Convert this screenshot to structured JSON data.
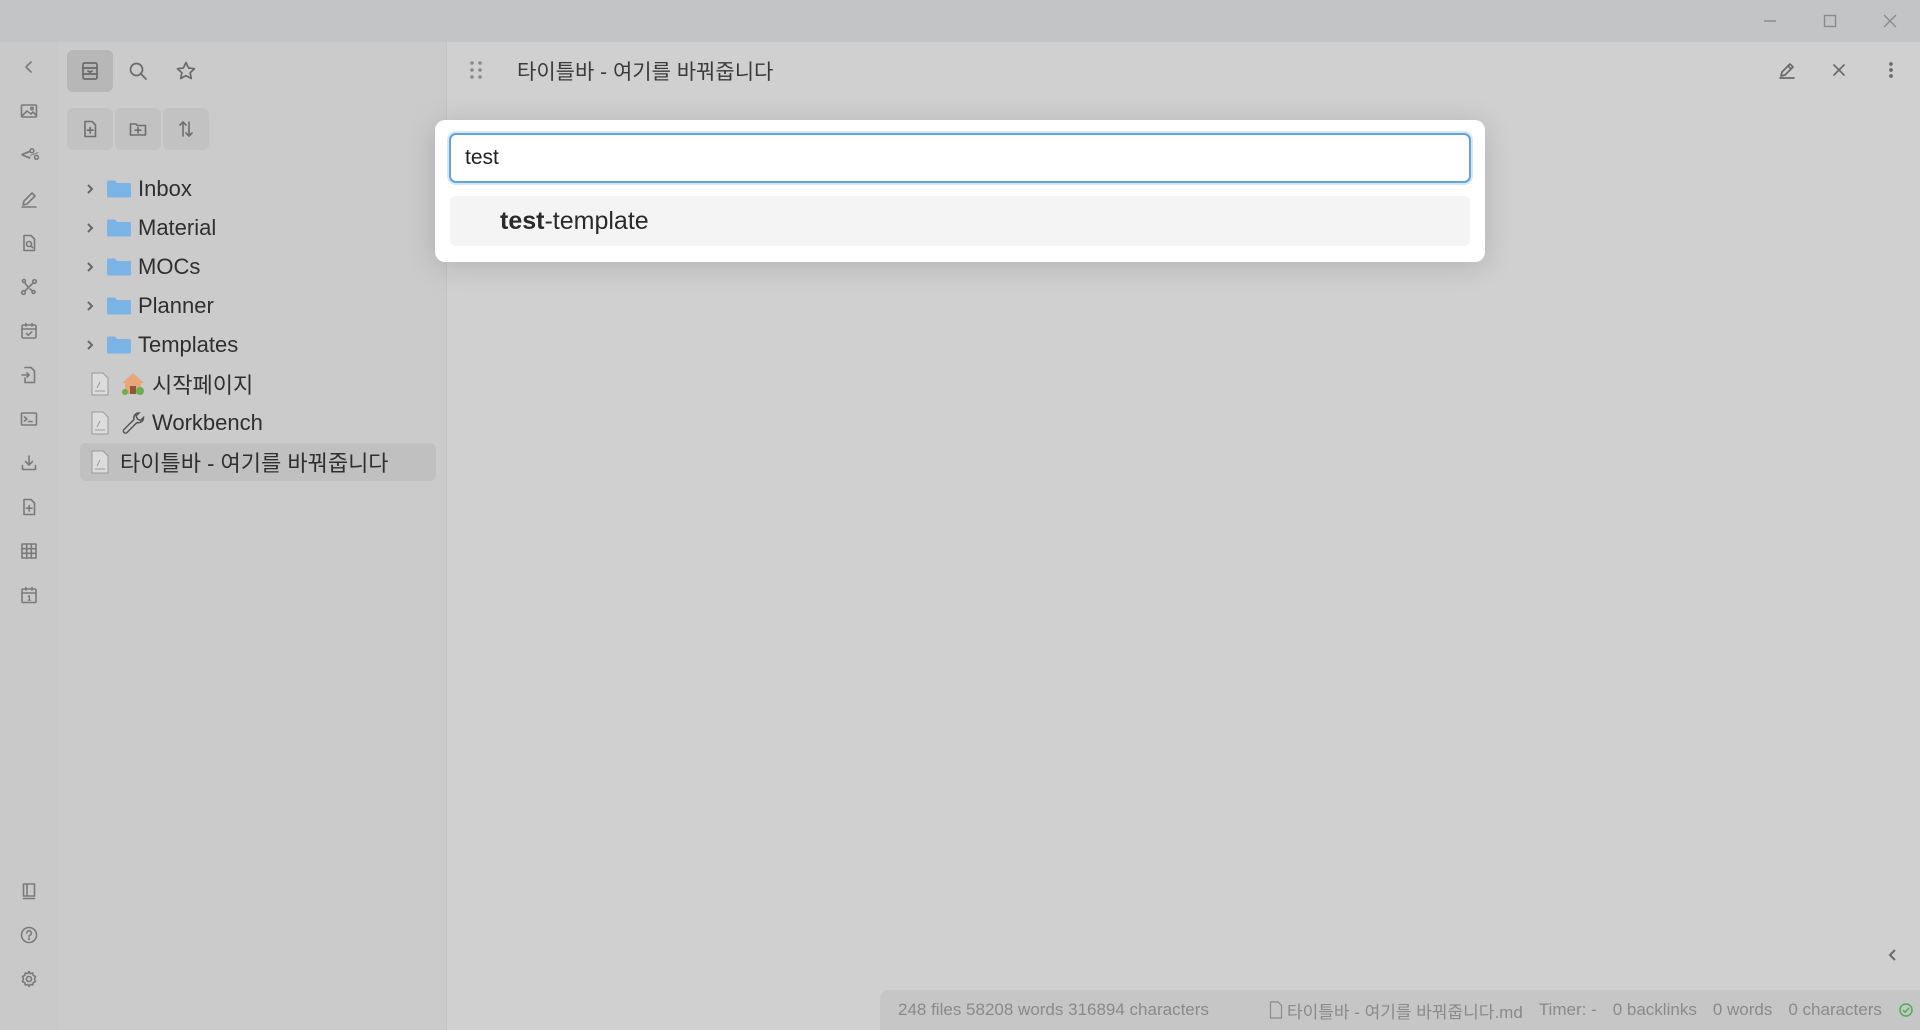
{
  "window": {
    "controls": [
      "minimize-icon",
      "maximize-icon",
      "close-icon"
    ]
  },
  "ribbon": {
    "items": [
      {
        "icon": "collapse-left-icon"
      },
      {
        "icon": "image-icon"
      },
      {
        "icon": "templater-icon",
        "label": "<%"
      },
      {
        "icon": "pencil-icon"
      },
      {
        "icon": "file-search-icon"
      },
      {
        "icon": "graph-icon"
      },
      {
        "icon": "calendar-check-icon"
      },
      {
        "icon": "file-import-icon"
      },
      {
        "icon": "terminal-icon"
      },
      {
        "icon": "download-icon"
      },
      {
        "icon": "file-plus-icon"
      },
      {
        "icon": "table-icon"
      },
      {
        "icon": "calendar-day-icon",
        "label": "1"
      }
    ],
    "bottom": [
      {
        "icon": "vault-book-icon"
      },
      {
        "icon": "help-icon"
      },
      {
        "icon": "settings-icon"
      }
    ]
  },
  "sidebar": {
    "tabs": [
      "files-icon",
      "search-icon",
      "bookmark-star-icon"
    ],
    "actions": [
      "new-note-icon",
      "new-folder-icon",
      "sort-icon"
    ],
    "tree": [
      {
        "type": "folder",
        "label": "Inbox"
      },
      {
        "type": "folder",
        "label": "Material"
      },
      {
        "type": "folder",
        "label": "MOCs"
      },
      {
        "type": "folder",
        "label": "Planner"
      },
      {
        "type": "folder",
        "label": "Templates"
      },
      {
        "type": "file",
        "label": "시작페이지",
        "emoji": "house-icon"
      },
      {
        "type": "file",
        "label": "Workbench",
        "emoji": "wrench-icon"
      },
      {
        "type": "file",
        "label": "타이틀바 - 여기를 바꿔줍니다",
        "active": true
      }
    ]
  },
  "main": {
    "title": "타이틀바 - 여기를 바꿔줍니다"
  },
  "modal": {
    "input_value": "test",
    "suggestions": [
      {
        "match": "test",
        "rest": "-template"
      }
    ]
  },
  "statusbar": {
    "vault_stats": "248 files 58208 words 316894 characters",
    "file_name": "타이틀바 - 여기를 바꿔줍니다.md",
    "timer": "Timer: -",
    "backlinks": "0 backlinks",
    "words": "0 words",
    "characters": "0 characters",
    "sync_icon": "sync-check-icon"
  },
  "colors": {
    "accent": "#5fa3e0",
    "folder": "#7ab3e6",
    "sync_ok": "#4caf50"
  }
}
